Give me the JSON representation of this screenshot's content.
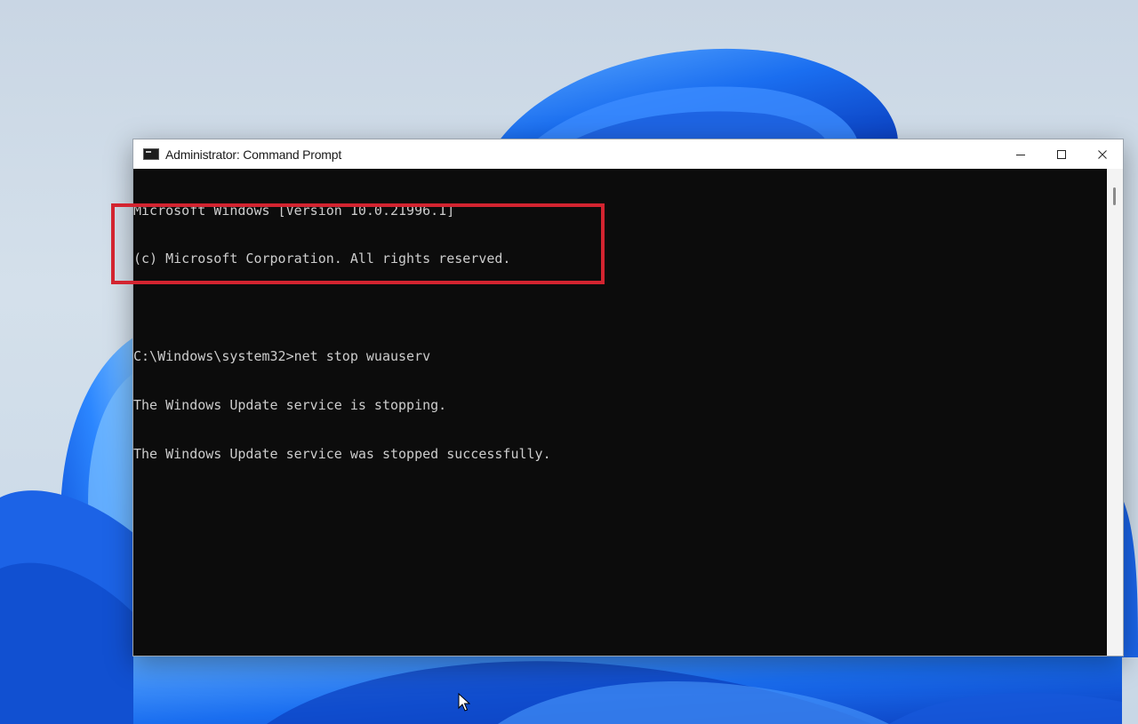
{
  "window": {
    "title": "Administrator: Command Prompt",
    "icon": "command-prompt-icon"
  },
  "caption_buttons": {
    "minimize_icon": "minimize-icon",
    "maximize_icon": "maximize-icon",
    "close_icon": "close-icon"
  },
  "console": {
    "lines": [
      "Microsoft Windows [Version 10.0.21996.1]",
      "(c) Microsoft Corporation. All rights reserved.",
      "",
      "C:\\Windows\\system32>net stop wuauserv",
      "The Windows Update service is stopping.",
      "The Windows Update service was stopped successfully."
    ]
  },
  "annotation": {
    "highlight_color": "#d32430"
  },
  "colors": {
    "console_bg": "#0c0c0c",
    "console_text": "#cccccc",
    "wallpaper_accent": "#1e6ee8"
  }
}
